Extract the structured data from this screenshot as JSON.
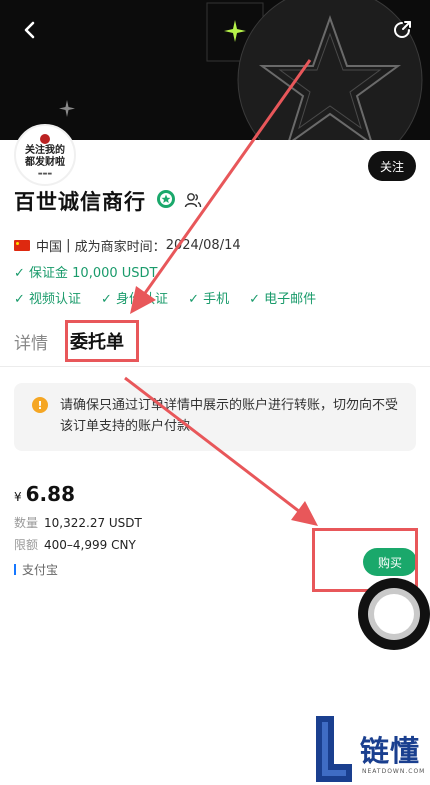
{
  "header": {
    "back_icon": "chevron-left-icon",
    "share_icon": "share-icon"
  },
  "avatar": {
    "line1": "关注我的",
    "line2": "都发财啦"
  },
  "merchant": {
    "follow_label": "关注",
    "name": "百世诚信商行",
    "country": "中国",
    "since_label": "成为商家时间：",
    "since_date": "2024/08/14",
    "deposit": "✓ 保证金 10,000 USDT",
    "verifications": [
      "✓ 视频认证",
      "✓ 身份认证",
      "✓ 手机",
      "✓ 电子邮件"
    ]
  },
  "tabs": {
    "details": "详情",
    "orders": "委托单"
  },
  "notice": {
    "icon": "!",
    "text": "请确保只通过订单详情中展示的账户进行转账，切勿向不受该订单支持的账户付款"
  },
  "order": {
    "currency_symbol": "¥",
    "price": "6.88",
    "quantity_label": "数量",
    "quantity_value": "10,322.27 USDT",
    "limit_label": "限额",
    "limit_value": "400–4,999 CNY",
    "payment_method": "支付宝",
    "buy_label": "购买"
  },
  "watermark": {
    "brand": "链懂",
    "site": "NEATDOWN.COM"
  },
  "colors": {
    "accent_green": "#1aa86b",
    "annotation_red": "#e8575a",
    "brand_blue": "#1a3f8f"
  }
}
